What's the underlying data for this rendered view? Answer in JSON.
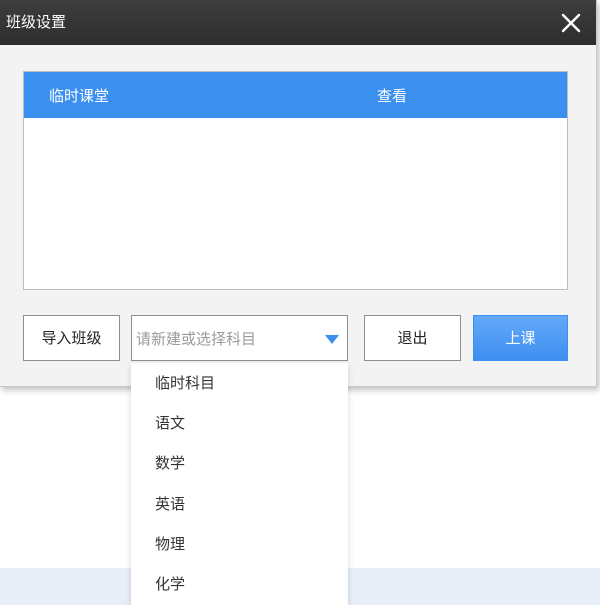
{
  "dialog": {
    "title": "班级设置",
    "close_icon": "close-icon"
  },
  "class_list": {
    "columns": [
      "临时课堂",
      "查看"
    ],
    "rows": []
  },
  "buttons": {
    "import_class": "导入班级",
    "exit": "退出",
    "start_class": "上课"
  },
  "subject_select": {
    "placeholder": "请新建或选择科目",
    "icon": "caret-down-icon",
    "options": [
      "临时科目",
      "语文",
      "数学",
      "英语",
      "物理",
      "化学"
    ]
  },
  "colors": {
    "accent": "#3b8fef",
    "titlebar": "#333333"
  }
}
